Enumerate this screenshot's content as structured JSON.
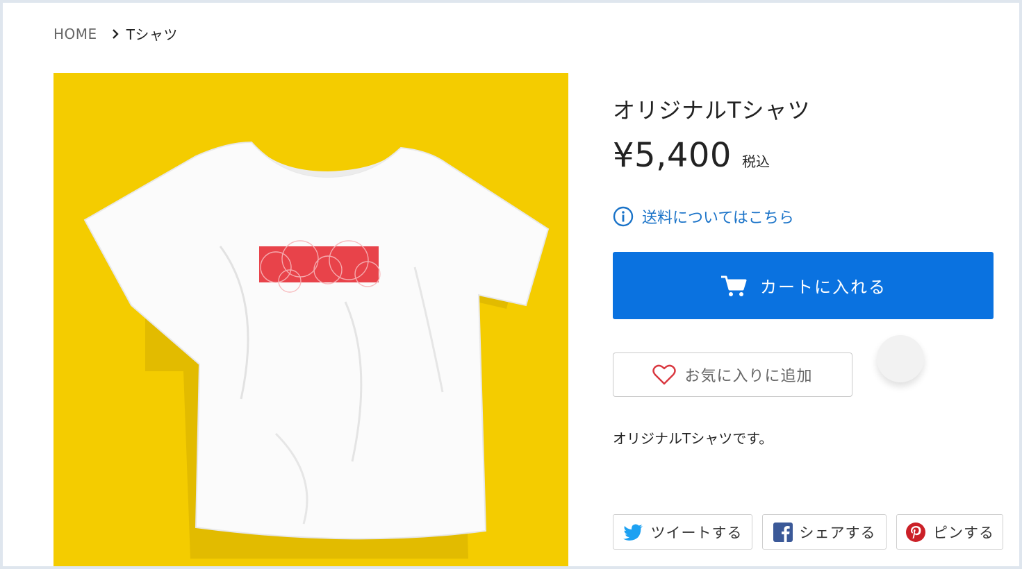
{
  "breadcrumb": {
    "home": "HOME",
    "current": "Tシャツ"
  },
  "product": {
    "title": "オリジナルTシャツ",
    "price": "¥5,400",
    "tax_label": "税込",
    "shipping_link": "送料についてはこちら",
    "description": "オリジナルTシャツです。"
  },
  "actions": {
    "cart_label": "カートに入れる",
    "favorite_label": "お気に入りに追加"
  },
  "share": {
    "tweet_label": "ツイートする",
    "facebook_label": "シェアする",
    "pinterest_label": "ピンする"
  },
  "colors": {
    "accent_blue": "#0a72e0",
    "link_blue": "#1a73c8",
    "image_background": "#f4cc00",
    "print_red": "#e8434a",
    "twitter": "#1da1f2",
    "facebook": "#3b5998",
    "pinterest": "#cb2027"
  }
}
